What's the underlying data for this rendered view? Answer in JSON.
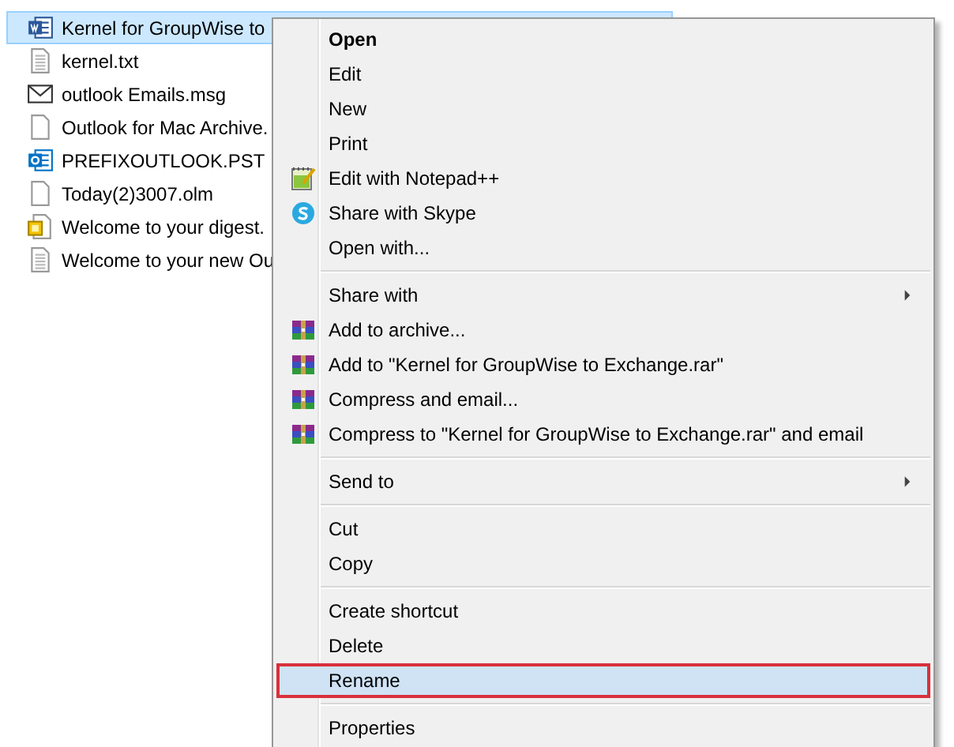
{
  "files": [
    {
      "name": "Kernel for GroupWise to",
      "kind": "word",
      "selected": true
    },
    {
      "name": "kernel.txt",
      "kind": "text",
      "selected": false
    },
    {
      "name": "outlook Emails.msg",
      "kind": "mail",
      "selected": false
    },
    {
      "name": "Outlook for Mac Archive.",
      "kind": "blank",
      "selected": false
    },
    {
      "name": "PREFIXOUTLOOK.PST",
      "kind": "outlook",
      "selected": false
    },
    {
      "name": "Today(2)3007.olm",
      "kind": "blank",
      "selected": false
    },
    {
      "name": "Welcome to your digest.",
      "kind": "digest",
      "selected": false
    },
    {
      "name": "Welcome to your new Ou",
      "kind": "text",
      "selected": false
    }
  ],
  "context_menu": {
    "groups": [
      [
        {
          "label": "Open",
          "kind": "plain",
          "default": true,
          "submenu": false,
          "selected": false
        },
        {
          "label": "Edit",
          "kind": "plain",
          "default": false,
          "submenu": false,
          "selected": false
        },
        {
          "label": "New",
          "kind": "plain",
          "default": false,
          "submenu": false,
          "selected": false
        },
        {
          "label": "Print",
          "kind": "plain",
          "default": false,
          "submenu": false,
          "selected": false
        },
        {
          "label": "Edit with Notepad++",
          "kind": "notepad",
          "default": false,
          "submenu": false,
          "selected": false
        },
        {
          "label": "Share with Skype",
          "kind": "skype",
          "default": false,
          "submenu": false,
          "selected": false
        },
        {
          "label": "Open with...",
          "kind": "plain",
          "default": false,
          "submenu": false,
          "selected": false
        }
      ],
      [
        {
          "label": "Share with",
          "kind": "plain",
          "default": false,
          "submenu": true,
          "selected": false
        },
        {
          "label": "Add to archive...",
          "kind": "archive",
          "default": false,
          "submenu": false,
          "selected": false
        },
        {
          "label": "Add to \"Kernel for GroupWise to Exchange.rar\"",
          "kind": "archive",
          "default": false,
          "submenu": false,
          "selected": false
        },
        {
          "label": "Compress and email...",
          "kind": "archive",
          "default": false,
          "submenu": false,
          "selected": false
        },
        {
          "label": "Compress to \"Kernel for GroupWise to Exchange.rar\" and email",
          "kind": "archive",
          "default": false,
          "submenu": false,
          "selected": false
        }
      ],
      [
        {
          "label": "Send to",
          "kind": "plain",
          "default": false,
          "submenu": true,
          "selected": false
        }
      ],
      [
        {
          "label": "Cut",
          "kind": "plain",
          "default": false,
          "submenu": false,
          "selected": false
        },
        {
          "label": "Copy",
          "kind": "plain",
          "default": false,
          "submenu": false,
          "selected": false
        }
      ],
      [
        {
          "label": "Create shortcut",
          "kind": "plain",
          "default": false,
          "submenu": false,
          "selected": false
        },
        {
          "label": "Delete",
          "kind": "plain",
          "default": false,
          "submenu": false,
          "selected": false
        },
        {
          "label": "Rename",
          "kind": "plain",
          "default": false,
          "submenu": false,
          "selected": true
        }
      ],
      [
        {
          "label": "Properties",
          "kind": "plain",
          "default": false,
          "submenu": false,
          "selected": false
        }
      ]
    ]
  }
}
